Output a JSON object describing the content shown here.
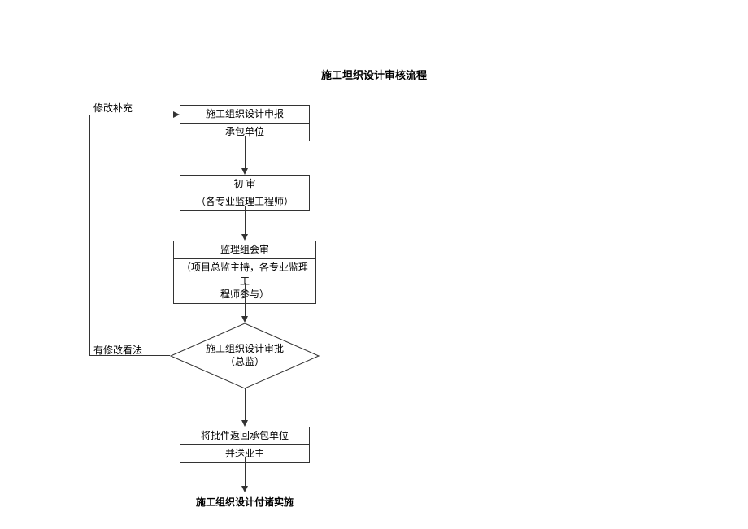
{
  "title": "施工坦织设计审核流程",
  "feedback_label_top": "修改补充",
  "box1": {
    "line1": "施工组织设计申报",
    "line2": "承包单位"
  },
  "box2": {
    "line1": "初    审",
    "line2": "（各专业监理工程师）"
  },
  "box3": {
    "line1": "监理组会审",
    "line2": "（项目总监主持，各专业监理工\n程师参与）"
  },
  "decision": {
    "line1": "施工组织设计审批",
    "line2": "（总监）"
  },
  "feedback_label_mid": "有修改看法",
  "box4": {
    "line1": "将批件返回承包单位",
    "line2": "并送业主"
  },
  "final": "施工组织设计付诸实施"
}
